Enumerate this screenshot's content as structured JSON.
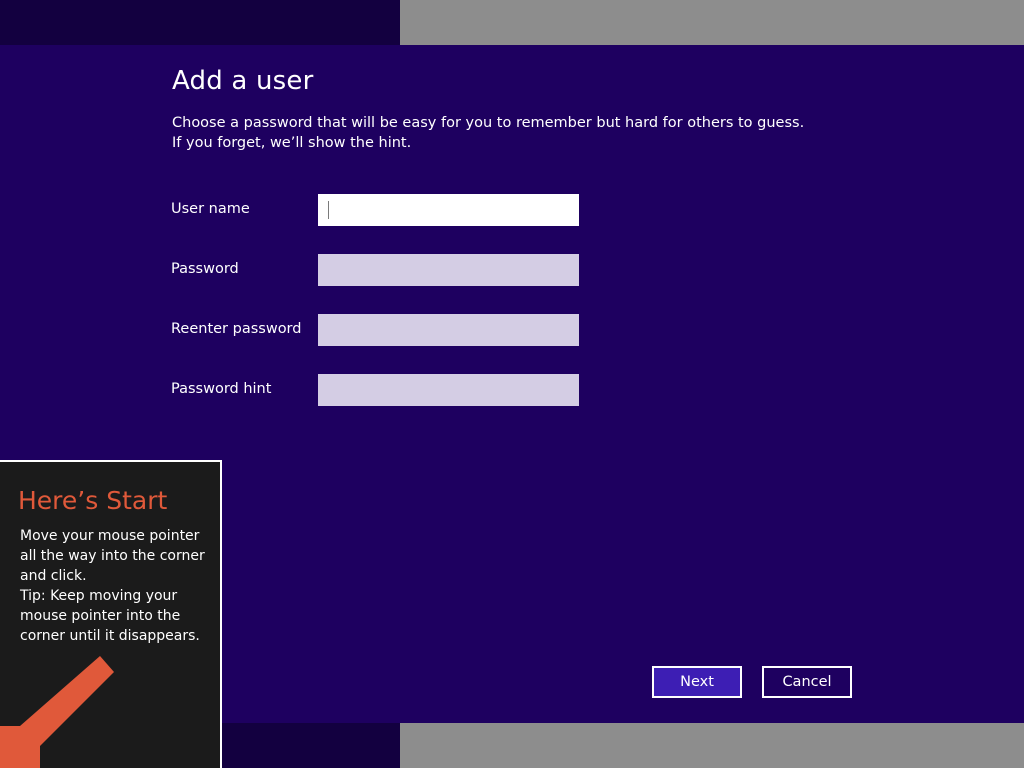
{
  "dialog": {
    "title": "Add a user",
    "subtitle": "Choose a password that will be easy for you to remember but hard for others to guess. If you forget, we’ll show the hint."
  },
  "fields": [
    {
      "label": "User name",
      "value": "",
      "placeholder": ""
    },
    {
      "label": "Password",
      "value": "",
      "placeholder": ""
    },
    {
      "label": "Reenter password",
      "value": "",
      "placeholder": ""
    },
    {
      "label": "Password hint",
      "value": "",
      "placeholder": ""
    }
  ],
  "buttons": {
    "next_label": "Next",
    "cancel_label": "Cancel"
  },
  "tip": {
    "title": "Here’s Start",
    "line1": "Move your mouse pointer all the way into the corner and click.",
    "line2": "Tip: Keep moving your mouse pointer into the corner until it disappears.",
    "arrow_icon": "arrow-down-left-icon"
  },
  "colors": {
    "background": "#1e0060",
    "accent_button": "#3d1eb4",
    "tip_title": "#e0593a",
    "tip_arrow": "#e0593a",
    "input_inactive": "#d4cde4"
  }
}
